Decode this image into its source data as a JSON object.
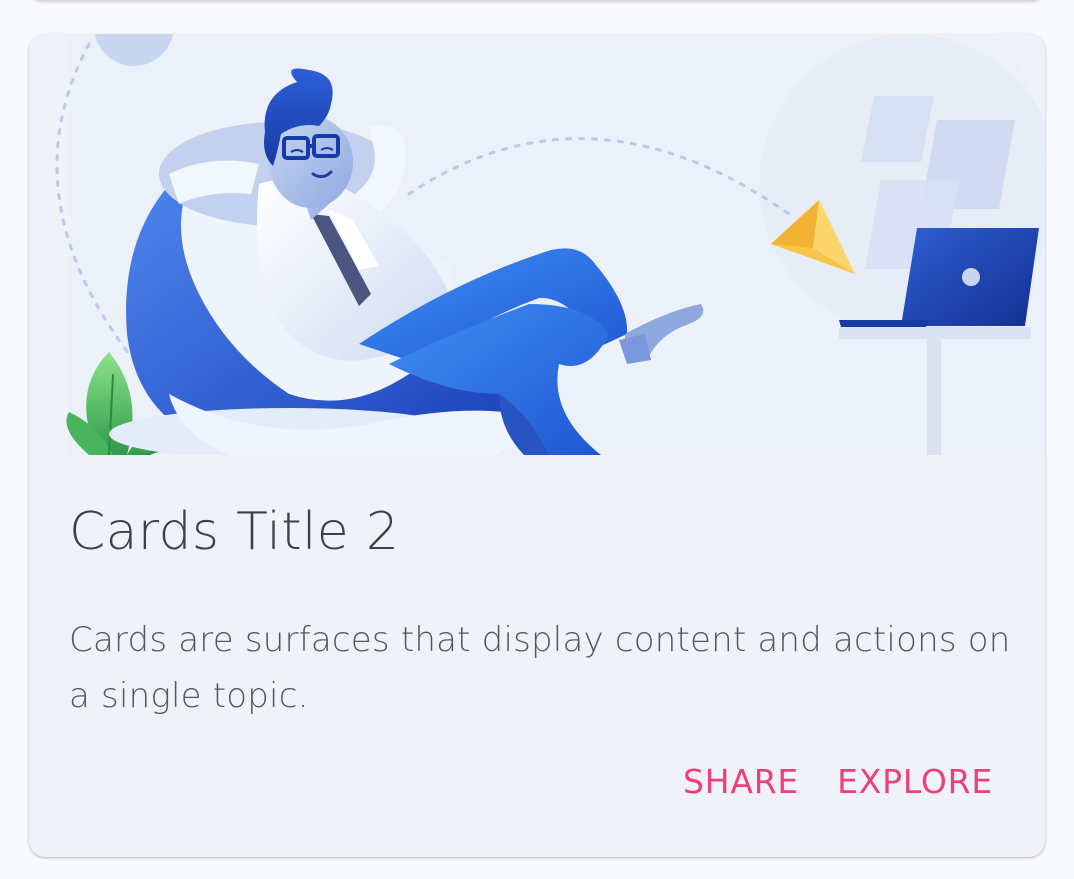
{
  "card": {
    "title": "Cards Title 2",
    "text": "Cards are surfaces that display content and actions on a single topic.",
    "actions": {
      "share_label": "SHARE",
      "explore_label": "EXPLORE"
    },
    "illustration": "person-relaxing-on-beanbag-sending-paper-plane-to-laptop"
  },
  "colors": {
    "card_background": "#eff2f9",
    "page_background": "#f9fafd",
    "title": "#3f3f44",
    "body_text": "#55565e",
    "action": "#ec407a",
    "illustration_blue": "#2a5fd6",
    "illustration_yellow": "#f7c548",
    "illustration_green": "#5cc46a"
  }
}
